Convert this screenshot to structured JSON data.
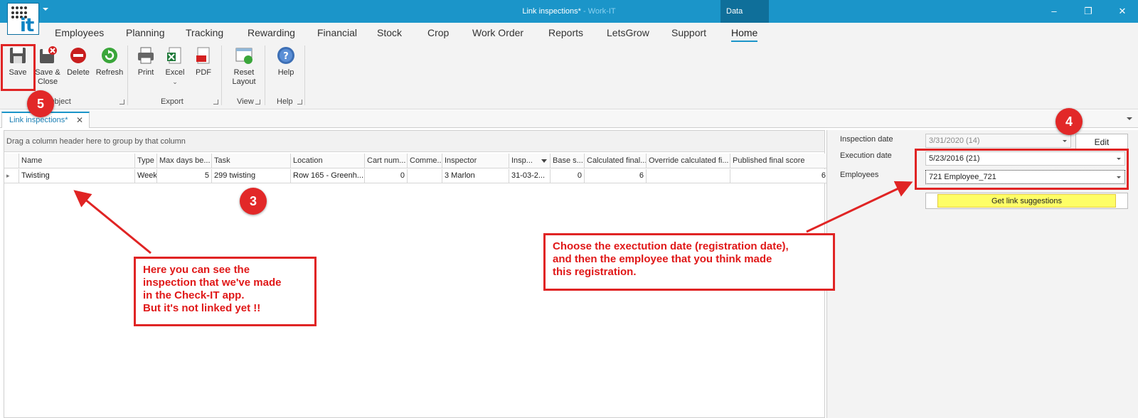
{
  "titlebar": {
    "document": "Link inspections*",
    "separator": " - ",
    "app": "Work-IT",
    "data_tab": "Data",
    "logo_text": "it"
  },
  "menu_tabs": [
    "Employees",
    "Planning",
    "Tracking",
    "Rewarding",
    "Financial",
    "Stock",
    "Crop",
    "Work Order",
    "Reports",
    "LetsGrow",
    "Support",
    "Home"
  ],
  "active_tab": "Home",
  "ribbon": {
    "object_group": {
      "label": "Object",
      "save": "Save",
      "save_close": "Save & Close",
      "delete": "Delete",
      "refresh": "Refresh"
    },
    "export_group": {
      "label": "Export",
      "print": "Print",
      "excel": "Excel",
      "pdf": "PDF"
    },
    "view_group": {
      "label": "View",
      "reset_layout": "Reset Layout"
    },
    "help_group": {
      "label": "Help",
      "help": "Help"
    }
  },
  "doc_tab": {
    "label": "Link inspections*",
    "close": "✕"
  },
  "grid": {
    "group_hint": "Drag a column header here to group by that column",
    "columns": [
      "Name",
      "Type",
      "Max days be...",
      "Task",
      "Location",
      "Cart num...",
      "Comme...",
      "Inspector",
      "Insp...",
      "Base s...",
      "Calculated final...",
      "Override calculated fi...",
      "Published final score"
    ],
    "rows": [
      [
        "Twisting",
        "Week",
        "5",
        "299 twisting",
        "Row 165 - Greenh...",
        "0",
        "",
        "3 Marlon",
        "31-03-2...",
        "0",
        "6",
        "",
        "6"
      ]
    ]
  },
  "panel": {
    "inspection_date_label": "Inspection date",
    "inspection_date_value": "3/31/2020 (14)",
    "edit_button": "Edit",
    "execution_date_label": "Execution date",
    "execution_date_value": "5/23/2016 (21)",
    "employees_label": "Employees",
    "employees_value": "721 Employee_721",
    "get_link_button": "Get link suggestions"
  },
  "annotations": {
    "badge_5": "5",
    "badge_4": "4",
    "badge_3": "3",
    "note_left_lines": [
      "Here you can see the",
      "inspection that we've made",
      "in the Check-IT app.",
      "But it's not linked yet !!"
    ],
    "note_right_lines": [
      "Choose the exectution date (registration date),",
      "and then the employee that you think made",
      "this registration."
    ]
  },
  "colors": {
    "titlebar": "#1b95c9",
    "annotation_red": "#e02424",
    "highlight_yellow": "#fefe66"
  }
}
